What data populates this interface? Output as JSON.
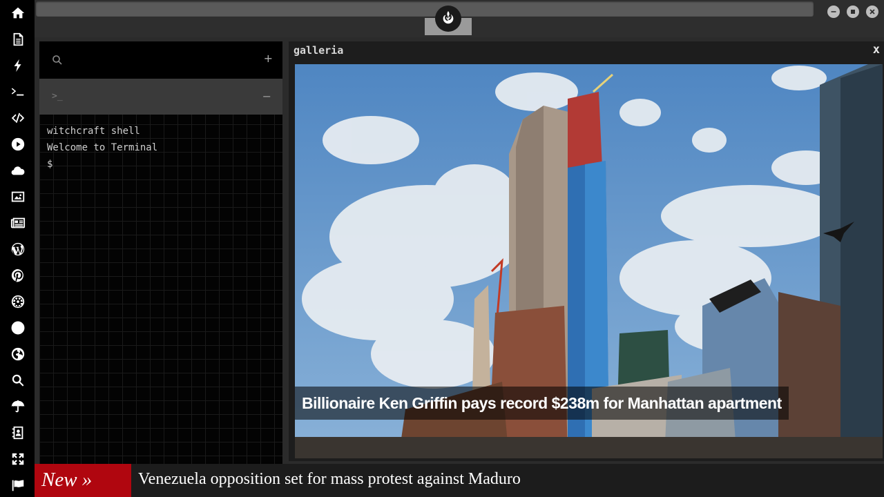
{
  "sidebar": {
    "icons": [
      "home-icon",
      "document-icon",
      "bolt-icon",
      "terminal-icon",
      "code-icon",
      "play-icon",
      "cloud-icon",
      "image-icon",
      "newspaper-icon",
      "wordpress-icon",
      "pinterest-icon",
      "empire-icon",
      "network-icon",
      "globe-icon",
      "search-icon",
      "umbrella-icon",
      "contact-book-icon",
      "expand-icon",
      "flag-icon"
    ]
  },
  "terminal": {
    "search_placeholder": "",
    "add_label": "+",
    "tab_prompt": ">_",
    "collapse_label": "−",
    "lines": [
      "witchcraft shell",
      "Welcome to Terminal",
      "$"
    ]
  },
  "gallery": {
    "title": "galleria",
    "close_label": "x",
    "caption": "Billionaire Ken Griffin pays record $238m for Manhattan apartment"
  },
  "ticker": {
    "label": "New »",
    "headline": "Venezuela opposition set for mass protest against Maduro"
  },
  "colors": {
    "ticker_label_bg": "#b0060f",
    "sidebar_bg": "#000000",
    "panel_bg": "#030303"
  }
}
